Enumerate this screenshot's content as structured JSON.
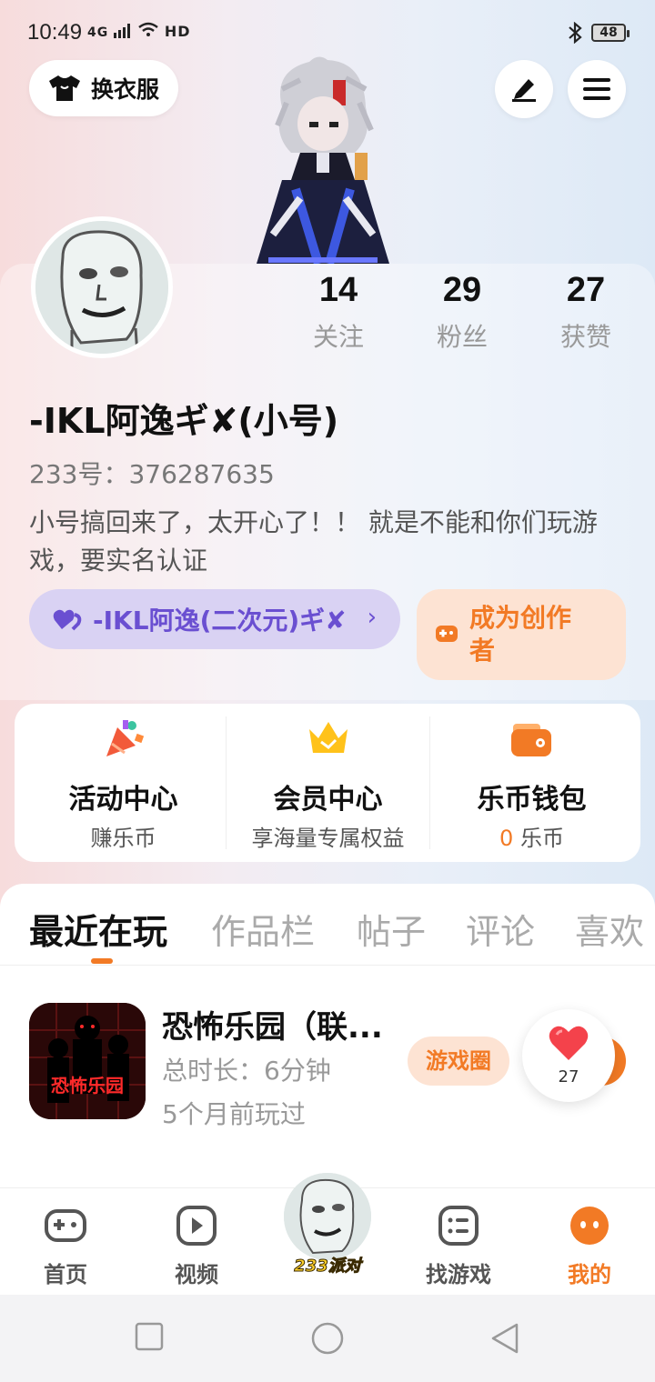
{
  "status_bar": {
    "time": "10:49",
    "signal_text": "4G",
    "hd_text": "HD",
    "battery": "48"
  },
  "header": {
    "outfit_label": "换衣服",
    "edit_icon": "pen-icon",
    "menu_icon": "menu-icon"
  },
  "profile": {
    "stats": [
      {
        "value": "14",
        "label": "关注"
      },
      {
        "value": "29",
        "label": "粉丝"
      },
      {
        "value": "27",
        "label": "获赞"
      }
    ],
    "nickname": "-IKL阿逸ギ✘(小号)",
    "uid": "233号：376287635",
    "bio": "小号搞回来了，太开心了！！ 就是不能和你们玩游戏，要实名认证",
    "group_label": "-IKL阿逸(二次元)ギ✘",
    "creator_label": "成为创作者"
  },
  "features": [
    {
      "title": "活动中心",
      "sub": "赚乐币",
      "icon": "party-popper-icon"
    },
    {
      "title": "会员中心",
      "sub": "享海量专属权益",
      "icon": "crown-icon"
    },
    {
      "title": "乐币钱包",
      "sub_value": "0",
      "sub_unit": " 乐币",
      "icon": "wallet-icon"
    }
  ],
  "tabs": [
    "最近在玩",
    "作品栏",
    "帖子",
    "评论",
    "喜欢"
  ],
  "recent_game": {
    "title": "恐怖乐园（联...",
    "icon_text": "恐怖乐园",
    "duration": "总时长：6分钟",
    "last_played": "5个月前玩过",
    "circle_label": "游戏圈",
    "likes": "27"
  },
  "bottom_nav": [
    {
      "label": "首页",
      "icon": "gamepad-icon"
    },
    {
      "label": "视频",
      "icon": "play-icon"
    },
    {
      "label": "233派对",
      "icon": "avatar"
    },
    {
      "label": "找游戏",
      "icon": "list-icon"
    },
    {
      "label": "我的",
      "icon": "profile-icon"
    }
  ],
  "colors": {
    "accent": "#f27a25",
    "purple": "#6a4fd1"
  }
}
